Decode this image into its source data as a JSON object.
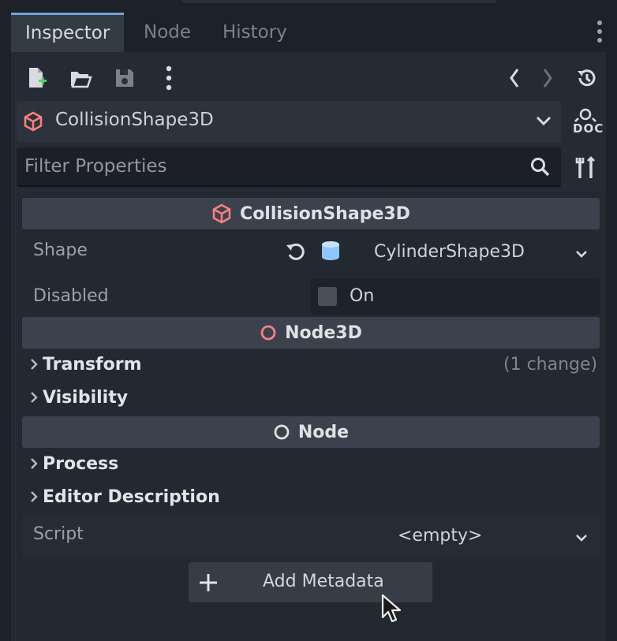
{
  "tabs": [
    {
      "label": "Inspector",
      "active": true
    },
    {
      "label": "Node",
      "active": false
    },
    {
      "label": "History",
      "active": false
    }
  ],
  "toolbar": {
    "icons": [
      "new-resource-icon",
      "open-folder-icon",
      "save-icon",
      "more-vertical-icon",
      "back-arrow-icon",
      "forward-arrow-icon",
      "history-icon"
    ]
  },
  "object_selector": {
    "label": "CollisionShape3D",
    "icon": "collision-shape-icon",
    "doc_label": "DOC"
  },
  "filter": {
    "placeholder": "Filter Properties"
  },
  "sections": {
    "collision_header": "CollisionShape3D",
    "node3d_header": "Node3D",
    "node_header": "Node"
  },
  "properties": {
    "shape_label": "Shape",
    "shape_value": "CylinderShape3D",
    "disabled_label": "Disabled",
    "disabled_on_label": "On",
    "disabled_checked": false,
    "script_label": "Script",
    "script_value": "<empty>"
  },
  "groups": {
    "transform": "Transform",
    "transform_note": "(1 change)",
    "visibility": "Visibility",
    "process": "Process",
    "editor_description": "Editor Description"
  },
  "add_metadata": {
    "label": "Add Metadata"
  },
  "colors": {
    "accent": "#70a3d8",
    "collision_icon": "#fc7f7f",
    "cylinder_icon": "#8fc6ff"
  }
}
